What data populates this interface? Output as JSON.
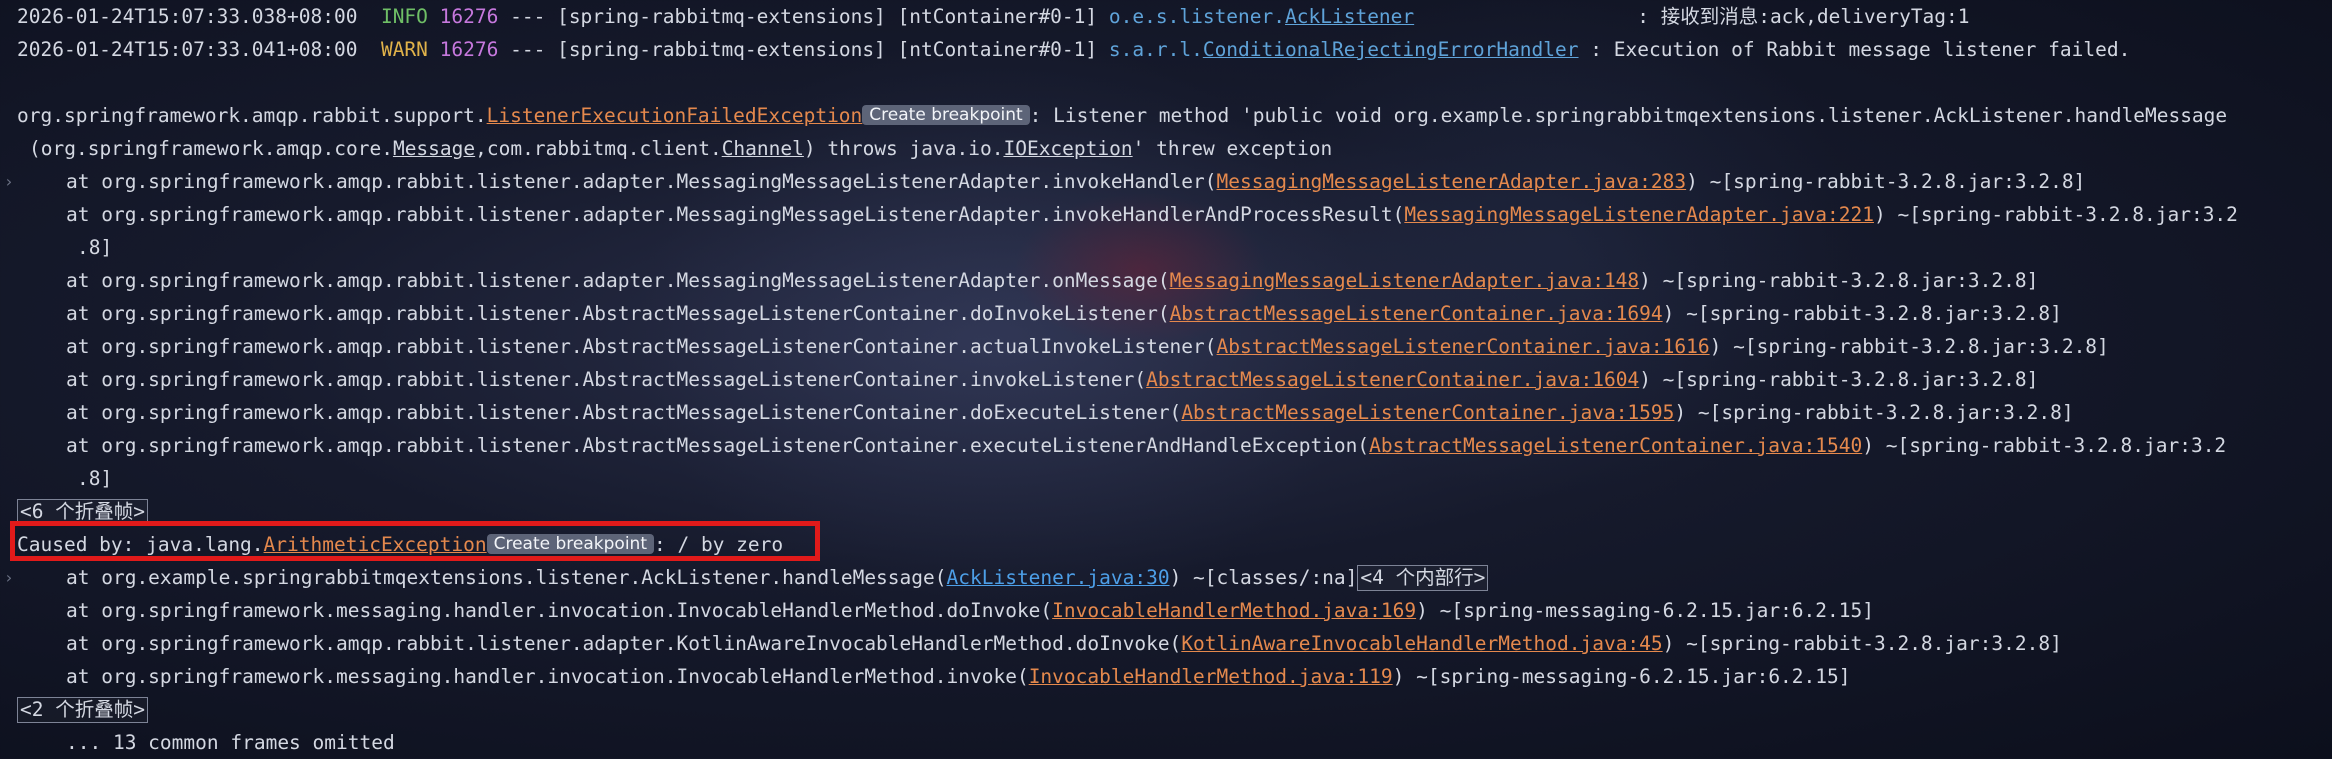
{
  "log_lines": [
    {
      "timestamp": "2026-01-24T15:07:33.038+08:00",
      "level": "INFO",
      "pid": "16276",
      "sep": " --- ",
      "app": "[spring-rabbitmq-extensions]",
      "thread": "[ntContainer#0-1]",
      "logger_prefix": "o.e.s.listener.",
      "logger_class": "AckListener",
      "message": ": 接收到消息:ack,deliveryTag:1"
    },
    {
      "timestamp": "2026-01-24T15:07:33.041+08:00",
      "level": "WARN",
      "pid": "16276",
      "sep": " --- ",
      "app": "[spring-rabbitmq-extensions]",
      "thread": "[ntContainer#0-1]",
      "logger_prefix": "s.a.r.l.",
      "logger_class": "ConditionalRejectingErrorHandler",
      "message": ": Execution of Rabbit message listener failed."
    }
  ],
  "exception": {
    "package": "org.springframework.amqp.rabbit.support.",
    "class": "ListenerExecutionFailedException",
    "create_breakpoint": "Create breakpoint",
    "message_a": ": Listener method 'public void org.example.springrabbitmqextensions.listener.AckListener.handleMessage",
    "message_b_1": "(org.springframework.amqp.core.",
    "message_b_msg": "Message",
    "message_b_2": ",com.rabbitmq.client.",
    "message_b_chan": "Channel",
    "message_b_3": ") throws java.io.",
    "message_b_ioe": "IOException",
    "message_b_4": "' threw exception"
  },
  "frames1": [
    {
      "prefix": "at org.springframework.amqp.rabbit.listener.adapter.MessagingMessageListenerAdapter.invokeHandler(",
      "link": "MessagingMessageListenerAdapter.java:283",
      "suffix": ") ~[spring-rabbit-3.2.8.jar:3.2.8]"
    },
    {
      "prefix": "at org.springframework.amqp.rabbit.listener.adapter.MessagingMessageListenerAdapter.invokeHandlerAndProcessResult(",
      "link": "MessagingMessageListenerAdapter.java:221",
      "suffix": ") ~[spring-rabbit-3.2.8.jar:3.2",
      "wrap": ".8]"
    },
    {
      "prefix": "at org.springframework.amqp.rabbit.listener.adapter.MessagingMessageListenerAdapter.onMessage(",
      "link": "MessagingMessageListenerAdapter.java:148",
      "suffix": ") ~[spring-rabbit-3.2.8.jar:3.2.8]"
    },
    {
      "prefix": "at org.springframework.amqp.rabbit.listener.AbstractMessageListenerContainer.doInvokeListener(",
      "link": "AbstractMessageListenerContainer.java:1694",
      "suffix": ") ~[spring-rabbit-3.2.8.jar:3.2.8]"
    },
    {
      "prefix": "at org.springframework.amqp.rabbit.listener.AbstractMessageListenerContainer.actualInvokeListener(",
      "link": "AbstractMessageListenerContainer.java:1616",
      "suffix": ") ~[spring-rabbit-3.2.8.jar:3.2.8]"
    },
    {
      "prefix": "at org.springframework.amqp.rabbit.listener.AbstractMessageListenerContainer.invokeListener(",
      "link": "AbstractMessageListenerContainer.java:1604",
      "suffix": ") ~[spring-rabbit-3.2.8.jar:3.2.8]"
    },
    {
      "prefix": "at org.springframework.amqp.rabbit.listener.AbstractMessageListenerContainer.doExecuteListener(",
      "link": "AbstractMessageListenerContainer.java:1595",
      "suffix": ") ~[spring-rabbit-3.2.8.jar:3.2.8]"
    },
    {
      "prefix": "at org.springframework.amqp.rabbit.listener.AbstractMessageListenerContainer.executeListenerAndHandleException(",
      "link": "AbstractMessageListenerContainer.java:1540",
      "suffix": ") ~[spring-rabbit-3.2.8.jar:3.2",
      "wrap": ".8]"
    }
  ],
  "fold1": "<6 个折叠帧>",
  "caused": {
    "prefix": "Caused by: java.lang.",
    "class": "ArithmeticException",
    "create_breakpoint": "Create breakpoint",
    "message": ": / by zero"
  },
  "frames2": [
    {
      "prefix": "at org.example.springrabbitmqextensions.listener.AckListener.handleMessage(",
      "link": "AckListener.java:30",
      "suffix": ") ~[classes/:na]",
      "internal": "<4 个内部行>"
    },
    {
      "prefix": "at org.springframework.messaging.handler.invocation.InvocableHandlerMethod.doInvoke(",
      "link": "InvocableHandlerMethod.java:169",
      "suffix": ") ~[spring-messaging-6.2.15.jar:6.2.15]"
    },
    {
      "prefix": "at org.springframework.amqp.rabbit.listener.adapter.KotlinAwareInvocableHandlerMethod.doInvoke(",
      "link": "KotlinAwareInvocableHandlerMethod.java:45",
      "suffix": ") ~[spring-rabbit-3.2.8.jar:3.2.8]"
    },
    {
      "prefix": "at org.springframework.messaging.handler.invocation.InvocableHandlerMethod.invoke(",
      "link": "InvocableHandlerMethod.java:119",
      "suffix": ") ~[spring-messaging-6.2.15.jar:6.2.15]"
    }
  ],
  "fold2": "<2 个折叠帧>",
  "omitted": "... 13 common frames omitted",
  "colors": {
    "highlight": "#e11a1a",
    "link": "#e5894d",
    "logger": "#5fa3d9",
    "info": "#6fbf66",
    "warn": "#e0b24a"
  }
}
